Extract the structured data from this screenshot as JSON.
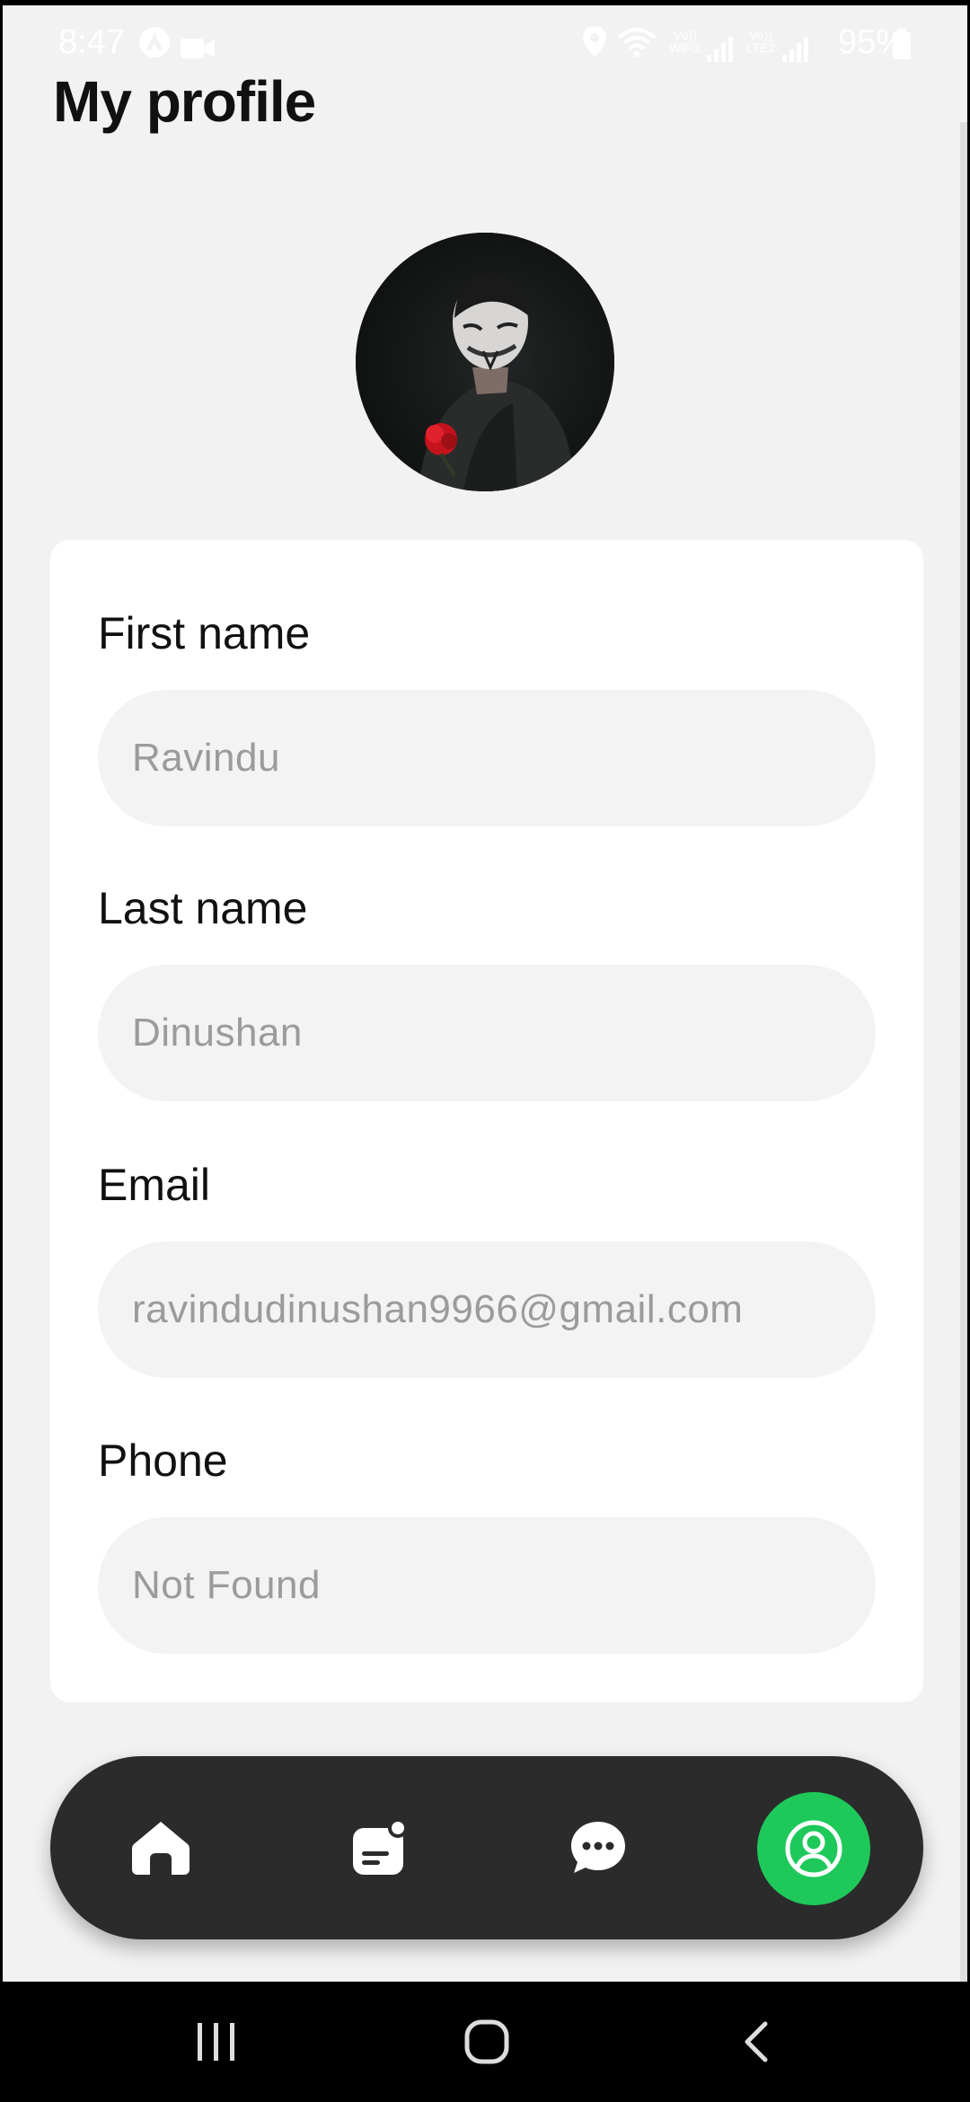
{
  "status_bar": {
    "time": "8:47",
    "battery_text": "95%",
    "sim1_label": "Vo))\nWiFi1",
    "sim2_label": "Vo))\nLTE2"
  },
  "page": {
    "title": "My profile"
  },
  "profile": {
    "fields": [
      {
        "label": "First name",
        "value": "Ravindu"
      },
      {
        "label": "Last name",
        "value": "Dinushan"
      },
      {
        "label": "Email",
        "value": "ravindudinushan9966@gmail.com"
      },
      {
        "label": "Phone",
        "value": "Not Found"
      }
    ]
  },
  "bottom_nav": {
    "items": [
      {
        "icon": "home-icon"
      },
      {
        "icon": "notes-icon"
      },
      {
        "icon": "chat-icon"
      },
      {
        "icon": "profile-icon",
        "active": true
      }
    ],
    "active_color": "#1ec95a",
    "bar_color": "#2b2b2b"
  },
  "system_nav": {
    "icons": [
      "recent-apps-icon",
      "home-circle-icon",
      "back-icon"
    ]
  }
}
